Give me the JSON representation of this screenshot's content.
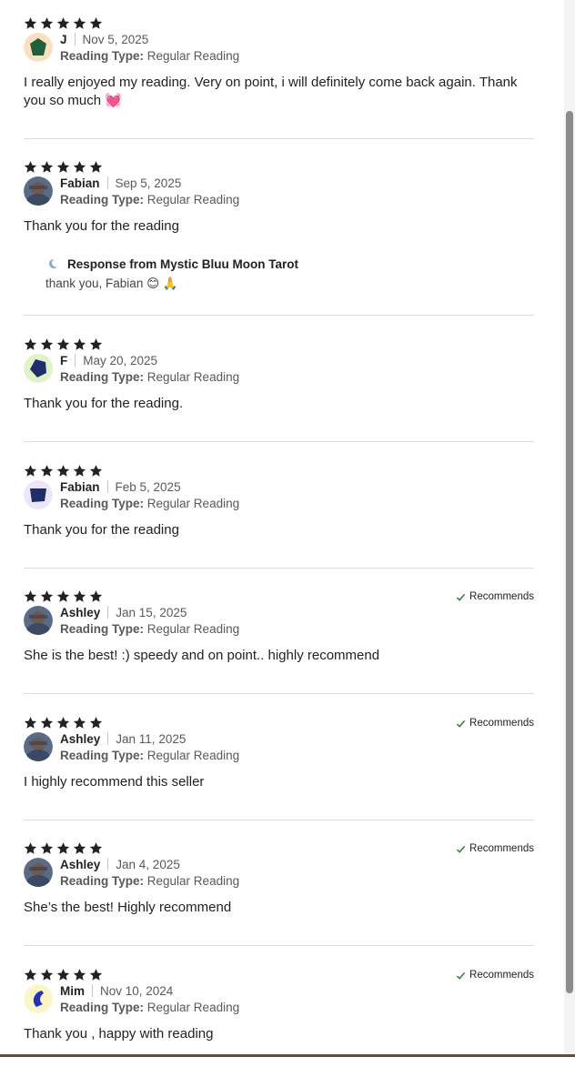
{
  "reviews": [
    {
      "rating": 5,
      "name": "J",
      "date": "Nov 5, 2025",
      "type_label": "Reading Type:",
      "type_value": "Regular Reading",
      "text": "I really enjoyed my reading. Very on point, i will definitely come back again. Thank you so much 💓",
      "recommends": "",
      "avatar": "green-pentagon-avatar"
    },
    {
      "rating": 5,
      "name": "Fabian",
      "date": "Sep 5, 2025",
      "type_label": "Reading Type:",
      "type_value": "Regular Reading",
      "text": "Thank you for the reading",
      "recommends": "",
      "avatar": "photo-avatar",
      "response": {
        "header": "Response from Mystic Bluu Moon Tarot",
        "text": "thank you, Fabian 😊 🙏",
        "icon": "moon-icon"
      }
    },
    {
      "rating": 5,
      "name": "F",
      "date": "May 20, 2025",
      "type_label": "Reading Type:",
      "type_value": "Regular Reading",
      "text": "Thank you for the reading.",
      "recommends": "",
      "avatar": "navy-pentagon-avatar"
    },
    {
      "rating": 5,
      "name": "Fabian",
      "date": "Feb 5, 2025",
      "type_label": "Reading Type:",
      "type_value": "Regular Reading",
      "text": "Thank you for the reading",
      "recommends": "",
      "avatar": "navy-trapezoid-avatar"
    },
    {
      "rating": 5,
      "name": "Ashley",
      "date": "Jan 15, 2025",
      "type_label": "Reading Type:",
      "type_value": "Regular Reading",
      "text": "She is the best! :) speedy and on point.. highly recommend",
      "recommends": "Recommends",
      "avatar": "photo-avatar"
    },
    {
      "rating": 5,
      "name": "Ashley",
      "date": "Jan 11, 2025",
      "type_label": "Reading Type:",
      "type_value": "Regular Reading",
      "text": "I highly recommend this seller",
      "recommends": "Recommends",
      "avatar": "photo-avatar"
    },
    {
      "rating": 5,
      "name": "Ashley",
      "date": "Jan 4, 2025",
      "type_label": "Reading Type:",
      "type_value": "Regular Reading",
      "text": "She’s the best! Highly recommend",
      "recommends": "Recommends",
      "avatar": "photo-avatar"
    },
    {
      "rating": 5,
      "name": "Mim",
      "date": "Nov 10, 2024",
      "type_label": "Reading Type:",
      "type_value": "Regular Reading",
      "text": "Thank you , happy with reading",
      "recommends": "Recommends",
      "avatar": "blue-crescent-avatar"
    }
  ],
  "colors": {
    "star": "#222222",
    "divider": "#dcdcdc",
    "check": "#2d7a2d",
    "bottom_bar": "#6b4b3e"
  }
}
